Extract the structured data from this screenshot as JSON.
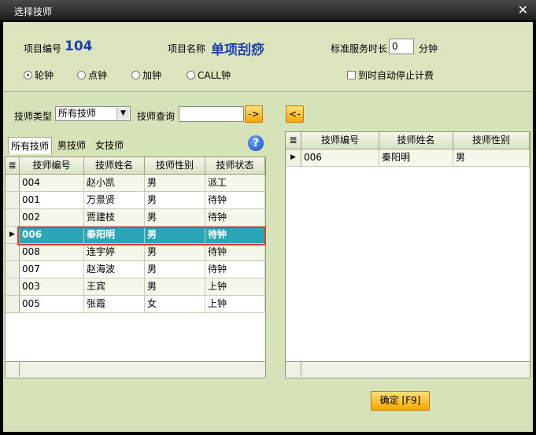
{
  "window": {
    "title": "选择技师"
  },
  "project": {
    "number_label": "项目编号",
    "number_value": "104",
    "name_label": "项目名称",
    "name_value": "单项刮痧",
    "duration_label": "标准服务时长",
    "duration_value": "0",
    "duration_unit": "分钟"
  },
  "modes": [
    {
      "label": "轮钟",
      "checked": true
    },
    {
      "label": "点钟",
      "checked": false
    },
    {
      "label": "加钟",
      "checked": false
    },
    {
      "label": "CALL钟",
      "checked": false
    }
  ],
  "auto_stop": {
    "label": "到时自动停止计费",
    "checked": false
  },
  "filter": {
    "type_label": "技师类型",
    "type_value": "所有技师",
    "query_label": "技师查询",
    "query_value": "",
    "query_button": "->",
    "back_button": "<-"
  },
  "tabs": [
    "所有技师",
    "男技师",
    "女技师"
  ],
  "help_icon": "question-mark-icon",
  "left_table": {
    "columns": [
      "技师编号",
      "技师姓名",
      "技师性别",
      "技师状态"
    ],
    "rows": [
      [
        "004",
        "赵小凯",
        "男",
        "派工"
      ],
      [
        "001",
        "万景贤",
        "男",
        "待钟"
      ],
      [
        "002",
        "贾建枝",
        "男",
        "待钟"
      ],
      [
        "006",
        "秦阳明",
        "男",
        "待钟"
      ],
      [
        "008",
        "连宇婷",
        "男",
        "待钟"
      ],
      [
        "007",
        "赵海波",
        "男",
        "待钟"
      ],
      [
        "003",
        "王宾",
        "男",
        "上钟"
      ],
      [
        "005",
        "张霞",
        "女",
        "上钟"
      ]
    ],
    "selected_index": 3
  },
  "right_table": {
    "columns": [
      "技师编号",
      "技师姓名",
      "技师性别"
    ],
    "rows": [
      [
        "006",
        "秦阳明",
        "男"
      ]
    ]
  },
  "confirm_button": "确定 [F9]",
  "colors": {
    "selection": "#2aa6b8",
    "highlight_border": "#e23a3a",
    "accent_button": "#f6a800"
  }
}
